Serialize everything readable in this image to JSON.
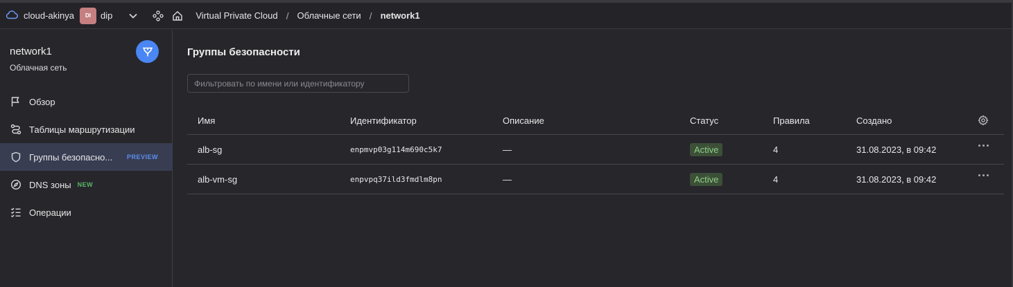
{
  "topbar": {
    "cloud_name": "cloud-akinya",
    "folder_avatar": "DI",
    "folder_name": "dip",
    "icons": [
      "cloud-icon",
      "chevron-down-icon",
      "services-icon",
      "home-icon"
    ],
    "breadcrumbs": [
      "Virtual Private Cloud",
      "Облачные сети",
      "network1"
    ],
    "separator": "/"
  },
  "sidebar": {
    "title": "network1",
    "subtitle": "Облачная сеть",
    "badge_icon": "network-icon",
    "items": [
      {
        "label": "Обзор",
        "icon": "flag-icon",
        "tag": ""
      },
      {
        "label": "Таблицы маршрутизации",
        "icon": "route-icon",
        "tag": ""
      },
      {
        "label": "Группы безопасно...",
        "icon": "shield-icon",
        "tag": "PREVIEW",
        "active": true
      },
      {
        "label": "DNS зоны",
        "icon": "compass-icon",
        "tag": "NEW"
      },
      {
        "label": "Операции",
        "icon": "checklist-icon",
        "tag": ""
      }
    ]
  },
  "main": {
    "title": "Группы безопасности",
    "filter_placeholder": "Фильтровать по имени или идентификатору",
    "columns": [
      "Имя",
      "Идентификатор",
      "Описание",
      "Статус",
      "Правила",
      "Создано"
    ],
    "rows": [
      {
        "name": "alb-sg",
        "id": "enpmvp03g114m690c5k7",
        "description": "—",
        "status": "Active",
        "rules": "4",
        "created": "31.08.2023, в 09:42"
      },
      {
        "name": "alb-vm-sg",
        "id": "enpvpq37ild3fmdlm8pn",
        "description": "—",
        "status": "Active",
        "rules": "4",
        "created": "31.08.2023, в 09:42"
      }
    ]
  },
  "colors": {
    "background": "#27262b",
    "accent": "#4a86f4",
    "active_nav": "#383d52",
    "status_bg": "#3c4f37",
    "status_text": "#8fd089",
    "preview_tag": "#5b8fef",
    "new_tag": "#5ab769"
  }
}
